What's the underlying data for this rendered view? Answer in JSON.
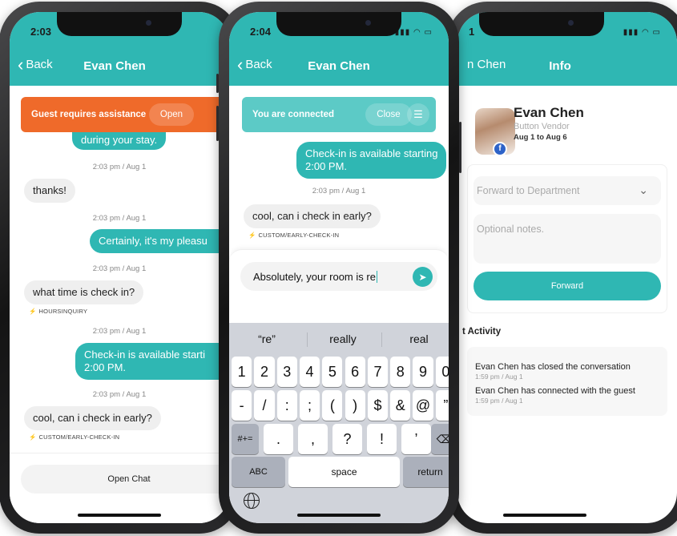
{
  "colors": {
    "accent": "#2fb7b3",
    "alert": "#ef6a2a"
  },
  "phone1": {
    "time": "2:03",
    "back_label": "Back",
    "title": "Evan Chen",
    "banner_text": "Guest requires assistance",
    "banner_button": "Open",
    "messages": [
      {
        "text": "during your stay."
      },
      {
        "stamp": "2:03 pm / Aug 1"
      },
      {
        "text": "thanks!"
      },
      {
        "stamp": "2:03 pm / Aug 1"
      },
      {
        "text": "Certainly, it's my pleasu"
      },
      {
        "stamp": "2:03 pm / Aug 1"
      },
      {
        "text": "what time is check in?",
        "tag": "HOURSINQUIRY"
      },
      {
        "stamp": "2:03 pm / Aug 1"
      },
      {
        "text": "Check-in is available starti",
        "text2": "2:00 PM."
      },
      {
        "stamp": "2:03 pm / Aug 1"
      },
      {
        "text": "cool, can i check in early?",
        "tag": "CUSTOM/EARLY-CHECK-IN"
      }
    ],
    "open_chat": "Open Chat"
  },
  "phone2": {
    "time": "2:04",
    "back_label": "Back",
    "title": "Evan Chen",
    "banner_text": "You are connected",
    "banner_button": "Close",
    "msg_out_1": "Check-in is available starting",
    "msg_out_2": "2:00 PM.",
    "stamp": "2:03 pm / Aug 1",
    "msg_in": "cool, can i check in early?",
    "msg_tag": "CUSTOM/EARLY-CHECK-IN",
    "compose_value": "Absolutely, your room is re",
    "suggestions": [
      "“re”",
      "really",
      "real"
    ],
    "row1": [
      "1",
      "2",
      "3",
      "4",
      "5",
      "6",
      "7",
      "8",
      "9",
      "0"
    ],
    "row2": [
      "-",
      "/",
      ":",
      ";",
      "(",
      ")",
      "$",
      "&",
      "@",
      "”"
    ],
    "row3_left": "#+=",
    "row3": [
      ".",
      ",",
      "?",
      "!",
      "’"
    ],
    "abc": "ABC",
    "space": "space",
    "return": "return"
  },
  "phone3": {
    "time": "1",
    "back_label": "n Chen",
    "title": "Info",
    "name": "Evan Chen",
    "subtitle": "Button Vendor",
    "dates": "Aug 1 to Aug 6",
    "dept_placeholder": "Forward to Department",
    "notes_placeholder": "Optional notes.",
    "forward_button": "Forward",
    "activity_title": "t Activity",
    "activities": [
      {
        "text": "Evan Chen has closed the conversation",
        "time": "1:59 pm / Aug 1"
      },
      {
        "text": "Evan Chen has connected with the guest",
        "time": "1:59 pm / Aug 1"
      }
    ]
  }
}
